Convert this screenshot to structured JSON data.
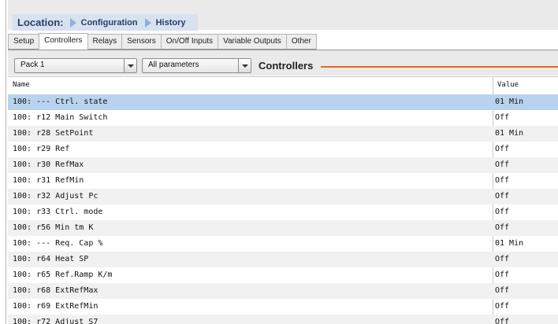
{
  "breadcrumb": {
    "location_label": "Location:",
    "items": [
      "Configuration",
      "History"
    ]
  },
  "tabs": [
    {
      "label": "Setup",
      "active": false
    },
    {
      "label": "Controllers",
      "active": true
    },
    {
      "label": "Relays",
      "active": false
    },
    {
      "label": "Sensors",
      "active": false
    },
    {
      "label": "On/Off Inputs",
      "active": false
    },
    {
      "label": "Variable Outputs",
      "active": false
    },
    {
      "label": "Other",
      "active": false
    }
  ],
  "toolbar": {
    "pack_select": "Pack 1",
    "param_select": "All parameters",
    "title": "Controllers"
  },
  "table": {
    "headers": [
      "Name",
      "Value"
    ],
    "rows": [
      {
        "name": "100: --- Ctrl. state",
        "value": "01 Min",
        "selected": true
      },
      {
        "name": "100: r12 Main Switch",
        "value": "Off"
      },
      {
        "name": "100: r28 SetPoint",
        "value": "01 Min"
      },
      {
        "name": "100: r29 Ref",
        "value": "Off"
      },
      {
        "name": "100: r30 RefMax",
        "value": "Off"
      },
      {
        "name": "100: r31 RefMin",
        "value": "Off"
      },
      {
        "name": "100: r32 Adjust Pc",
        "value": "Off"
      },
      {
        "name": "100: r33 Ctrl. mode",
        "value": "Off"
      },
      {
        "name": "100: r56 Min tm K",
        "value": "Off"
      },
      {
        "name": "100: --- Req. Cap %",
        "value": "01 Min"
      },
      {
        "name": "100: r64 Heat SP",
        "value": "Off"
      },
      {
        "name": "100: r65 Ref.Ramp K/m",
        "value": "Off"
      },
      {
        "name": "100: r68 ExtRefMax",
        "value": "Off"
      },
      {
        "name": "100: r69 ExtRefMin",
        "value": "Off"
      },
      {
        "name": "100: r72 Adjust S7",
        "value": "Off"
      }
    ]
  },
  "colors": {
    "breadcrumb_bg": "#d6e2f0",
    "selected_row": "#b9d3ee",
    "accent_line": "#e5661f"
  }
}
